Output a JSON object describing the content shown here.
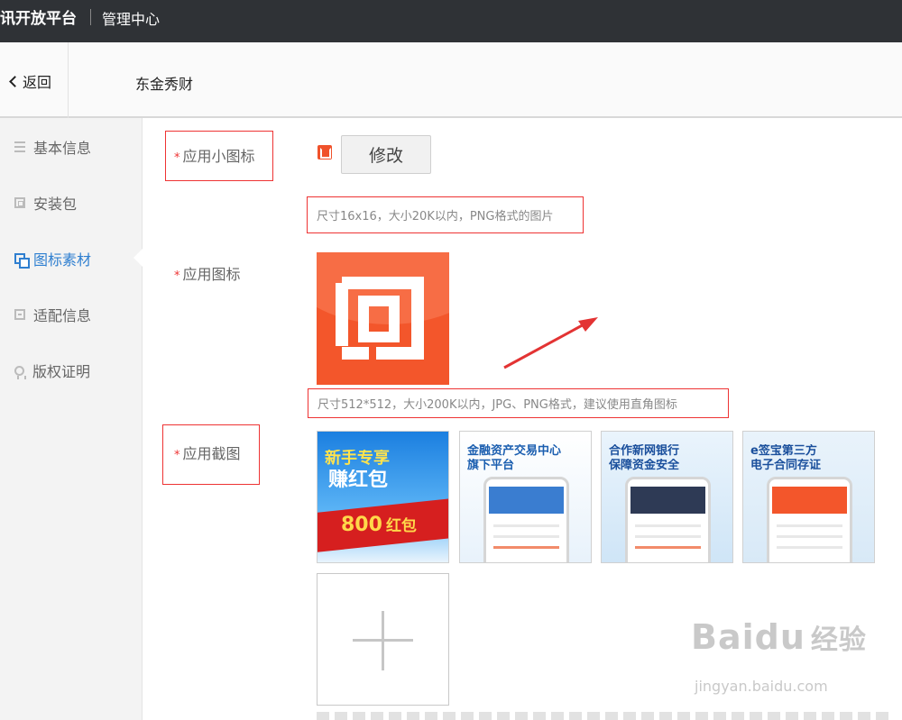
{
  "topbar": {
    "brand": "讯开放平台",
    "management": "管理中心"
  },
  "subbar": {
    "back_label": "返回",
    "app_name": "东金秀财"
  },
  "sidebar": {
    "items": [
      {
        "label": "基本信息",
        "icon": "list-icon",
        "active": false
      },
      {
        "label": "安装包",
        "icon": "package-icon",
        "active": false
      },
      {
        "label": "图标素材",
        "icon": "image-icon",
        "active": true
      },
      {
        "label": "适配信息",
        "icon": "document-icon",
        "active": false
      },
      {
        "label": "版权证明",
        "icon": "badge-icon",
        "active": false
      }
    ]
  },
  "form": {
    "required_mark": "*",
    "small_icon": {
      "label": "应用小图标",
      "button": "修改",
      "hint": "尺寸16x16，大小20K以内，PNG格式的图片"
    },
    "app_icon": {
      "label": "应用图标",
      "hint": "尺寸512*512，大小200K以内，JPG、PNG格式，建议使用直角图标"
    },
    "screenshots": {
      "label": "应用截图",
      "items": [
        {
          "caption_line1": "新手专享",
          "caption_line2": "赚红包",
          "extra": "800",
          "extra2": "红包"
        },
        {
          "caption_line1": "金融资产交易中心",
          "caption_line2": "旗下平台"
        },
        {
          "caption_line1": "合作新网银行",
          "caption_line2": "保障资金安全"
        },
        {
          "caption_line1": "e签宝第三方",
          "caption_line2": "电子合同存证"
        }
      ]
    }
  },
  "watermark": {
    "logo": "Baidu",
    "logo_cn": "经验",
    "url": "jingyan.baidu.com"
  },
  "colors": {
    "accent": "#2f7fd0",
    "required": "#e33333",
    "icon_orange": "#f3562b"
  }
}
